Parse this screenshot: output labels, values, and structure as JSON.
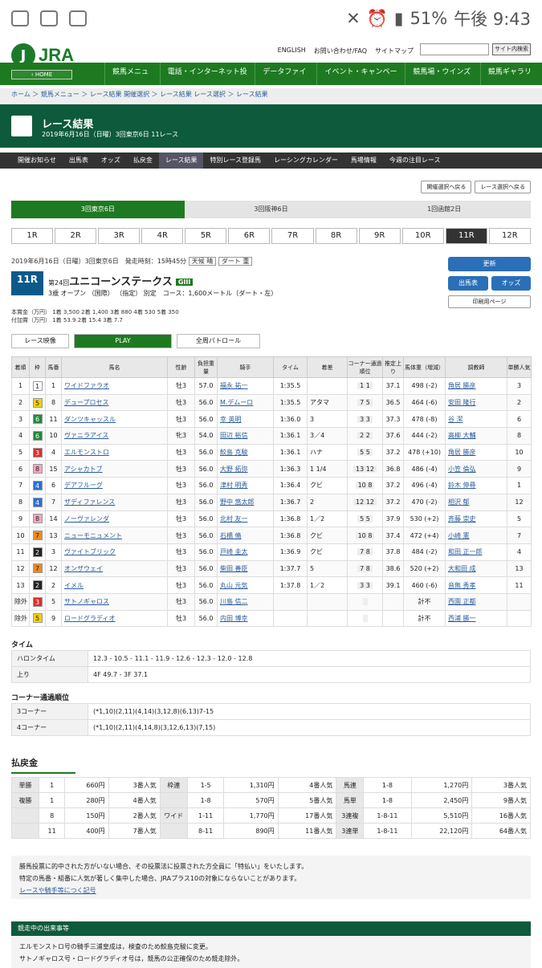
{
  "status": {
    "battery": "51%",
    "time": "午後 9:43"
  },
  "header": {
    "logo": "JRA",
    "home": "‹ HOME",
    "links": [
      "ENGLISH",
      "お問い合わせ/FAQ",
      "サイトマップ"
    ],
    "search_btn": "サイト内検索",
    "nav": [
      "競馬メニュー",
      "電話・インターネット投票",
      "データファイル",
      "イベント・キャンペーン",
      "競馬場・ウインズ等",
      "競馬ギャラリー"
    ]
  },
  "breadcrumb": "ホーム ＞ 競馬メニュー ＞ レース結果 開催選択 ＞ レース結果 レース選択 ＞ レース結果",
  "title": {
    "h": "レース結果",
    "s": "2019年6月16日（日曜）3回東京6日 11レース"
  },
  "subnav": [
    "開催お知らせ",
    "出馬表",
    "オッズ",
    "払戻金",
    "レース結果",
    "特別レース登録馬",
    "レーシングカレンダー",
    "馬場情報",
    "今週の注目レース"
  ],
  "selbtns": [
    "開催選択へ戻る",
    "レース選択へ戻る"
  ],
  "venues": [
    "3回東京6日",
    "3回阪神6日",
    "1回函館2日"
  ],
  "races": [
    "1R",
    "2R",
    "3R",
    "4R",
    "5R",
    "6R",
    "7R",
    "8R",
    "9R",
    "10R",
    "11R",
    "12R"
  ],
  "race": {
    "info": "2019年6月16日（日曜）3回東京6日　発走時刻：15時45分",
    "weather": "天候 晴",
    "track": "ダート 重",
    "no": "11R",
    "nth": "第24回",
    "name": "ユニコーンステークス",
    "grade": "GIII",
    "cond": "3歳 オープン （国際） （指定） 別定　コース：1,600メートル（ダート・左）",
    "prize1": "本賞金（万円） 1着 3,500 2着 1,400 3着 880 4着 530 5着 350",
    "prize2": "付加賞（万円） 1着 53.9 2着 15.4 3着 7.7"
  },
  "side": {
    "update": "更新",
    "entry": "出馬表",
    "odds": "オッズ",
    "print": "印刷用ページ"
  },
  "video": {
    "a": "レース映像",
    "b": "PLAY",
    "c": "全周パトロール"
  },
  "cols": [
    "着順",
    "枠",
    "馬番",
    "馬名",
    "性齢",
    "負担重量",
    "騎手",
    "タイム",
    "着差",
    "コーナー通過順位",
    "推定上り",
    "馬体重（増減）",
    "調教師",
    "単勝人気"
  ],
  "rows": [
    [
      "1",
      "1",
      "1",
      "ワイドファラオ",
      "牡3",
      "57.0",
      "福永 祐一",
      "1:35.5",
      "",
      "1 1",
      "37.1",
      "498 (-2)",
      "角居 勝彦",
      "3"
    ],
    [
      "2",
      "5",
      "8",
      "デュープロセス",
      "牡3",
      "56.0",
      "M.デムーロ",
      "1:35.5",
      "アタマ",
      "7 5",
      "36.5",
      "464 (-6)",
      "安田 隆行",
      "2"
    ],
    [
      "3",
      "6",
      "11",
      "ダンツキャッスル",
      "牡3",
      "56.0",
      "幸 英明",
      "1:36.0",
      "3",
      "3 3",
      "37.3",
      "478 (-8)",
      "谷 潔",
      "6"
    ],
    [
      "4",
      "6",
      "10",
      "ヴァニラアイス",
      "牝3",
      "54.0",
      "田辺 裕信",
      "1:36.1",
      "3／4",
      "2 2",
      "37.6",
      "444 (-2)",
      "高柳 大輔",
      "8"
    ],
    [
      "5",
      "3",
      "4",
      "エルモンストロ",
      "牡3",
      "56.0",
      "鮫島 克駿",
      "1:36.1",
      "ハナ",
      "5 5",
      "37.2",
      "478 (+10)",
      "角居 勝彦",
      "10"
    ],
    [
      "6",
      "8",
      "15",
      "アシャカトブ",
      "牡3",
      "56.0",
      "大野 拓弥",
      "1:36.3",
      "1 1/4",
      "13 12",
      "36.8",
      "486 (-4)",
      "小笠 倫弘",
      "9"
    ],
    [
      "7",
      "4",
      "6",
      "デアフルーグ",
      "牡3",
      "56.0",
      "津村 明秀",
      "1:36.4",
      "クビ",
      "10 8",
      "37.2",
      "496 (-4)",
      "鈴木 伸尋",
      "1"
    ],
    [
      "8",
      "4",
      "7",
      "ザディファレンス",
      "牡3",
      "56.0",
      "野中 悠太郎",
      "1:36.7",
      "2",
      "12 12",
      "37.2",
      "470 (-2)",
      "相沢 郁",
      "12"
    ],
    [
      "9",
      "8",
      "14",
      "ノーヴァレンダ",
      "牡3",
      "56.0",
      "北村 友一",
      "1:36.8",
      "1／2",
      "5 5",
      "37.9",
      "530 (+2)",
      "斉藤 崇史",
      "5"
    ],
    [
      "10",
      "7",
      "13",
      "ニューモニュメント",
      "牡3",
      "56.0",
      "石橋 脩",
      "1:36.8",
      "クビ",
      "10 8",
      "37.4",
      "472 (+4)",
      "小崎 憲",
      "7"
    ],
    [
      "11",
      "2",
      "3",
      "ヴァイトブリック",
      "牡3",
      "56.0",
      "戸崎 圭太",
      "1:36.9",
      "クビ",
      "7 8",
      "37.8",
      "484 (-2)",
      "和田 正一郎",
      "4"
    ],
    [
      "12",
      "7",
      "12",
      "オンザウェイ",
      "牡3",
      "56.0",
      "柴田 善臣",
      "1:37.7",
      "5",
      "7 8",
      "38.6",
      "520 (+2)",
      "大和田 成",
      "13"
    ],
    [
      "13",
      "2",
      "2",
      "イメル",
      "牡3",
      "56.0",
      "丸山 元気",
      "1:37.8",
      "1／2",
      "3 3",
      "39.1",
      "460 (-6)",
      "音無 秀孝",
      "11"
    ],
    [
      "除外",
      "3",
      "5",
      "サトノギャロス",
      "牡3",
      "56.0",
      "川島 信二",
      "",
      "",
      "",
      "",
      "計不",
      "西園 正都",
      ""
    ],
    [
      "除外",
      "5",
      "9",
      "ロードグラディオ",
      "牡3",
      "56.0",
      "内田 博幸",
      "",
      "",
      "",
      "",
      "計不",
      "西浦 勝一",
      ""
    ]
  ],
  "waku_colors": {
    "1": "#ffffff",
    "2": "#222222",
    "3": "#d9302c",
    "4": "#2a6fd6",
    "5": "#f5d000",
    "6": "#1f8a3a",
    "7": "#f08a1a",
    "8": "#f3a6c0"
  },
  "time": {
    "h": "タイム",
    "k1": "ハロンタイム",
    "v1": "12.3 - 10.5 - 11.1 - 11.9 - 12.6 - 12.3 - 12.0 - 12.8",
    "k2": "上り",
    "v2": "4F 49.7 - 3F 37.1"
  },
  "corner": {
    "h": "コーナー通過順位",
    "k1": "3コーナー",
    "v1": "(*1,10)(2,11)(4,14)(3,12,8)(6,13)7-15",
    "k2": "4コーナー",
    "v2": "(*1,10)(2,11)(4,14,8)(3,12,6,13)(7,15)"
  },
  "pay": {
    "h": "払戻金",
    "rows": [
      [
        "単勝",
        "1",
        "660円",
        "3番人気",
        "枠連",
        "1-5",
        "1,310円",
        "4番人気",
        "馬連",
        "1-8",
        "1,270円",
        "3番人気"
      ],
      [
        "複勝",
        "1",
        "280円",
        "4番人気",
        "",
        "1-8",
        "570円",
        "5番人気",
        "馬単",
        "1-8",
        "2,450円",
        "9番人気"
      ],
      [
        "",
        "8",
        "150円",
        "2番人気",
        "ワイド",
        "1-11",
        "1,770円",
        "17番人気",
        "3連複",
        "1-8-11",
        "5,510円",
        "16番人気"
      ],
      [
        "",
        "11",
        "400円",
        "7番人気",
        "",
        "8-11",
        "890円",
        "11番人気",
        "3連単",
        "1-8-11",
        "22,120円",
        "64番人気"
      ]
    ]
  },
  "notes": [
    "勝馬投票に的中された方がいない場合、その投票法に投票された方全員に「特払い」をいたします。",
    "特定の馬番・組番に人気が著しく集中した場合、JRAプラス10の対象にならないことがあります。",
    "レースや騎手等につく記号"
  ],
  "events": {
    "h": "競走中の出来事等",
    "l1": "エルモンストロ号の騎手三浦皇成は，検査のため鮫島克駿に変更。",
    "l2": "サトノギャロス号・ロードグラディオ号は，競馬の公正確保のため競走除外。"
  }
}
